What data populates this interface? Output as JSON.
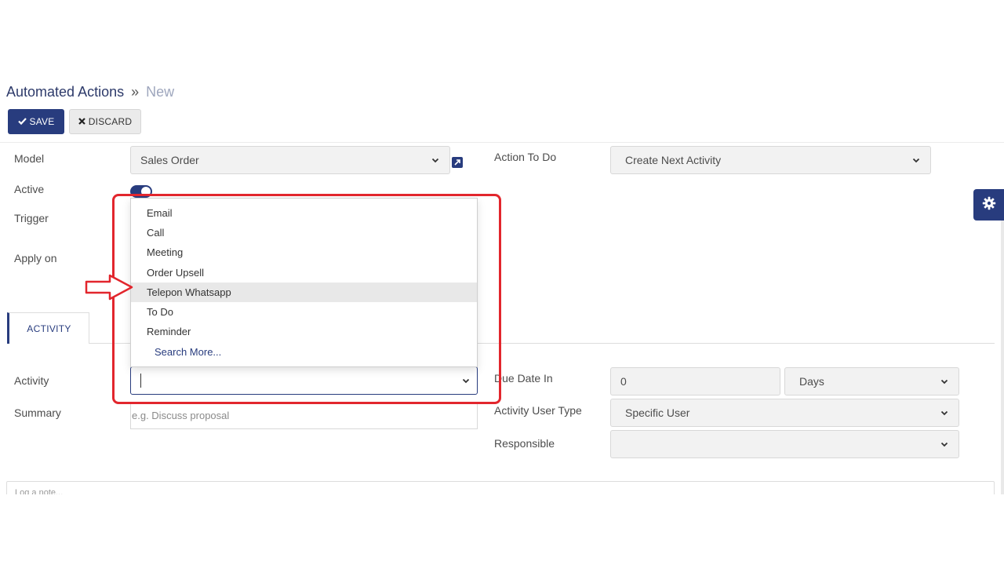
{
  "breadcrumb": {
    "parent": "Automated Actions",
    "separator": "»",
    "current": "New"
  },
  "toolbar": {
    "save_label": "SAVE",
    "discard_label": "DISCARD"
  },
  "form": {
    "model": {
      "label": "Model",
      "value": "Sales Order"
    },
    "active": {
      "label": "Active",
      "checked": true
    },
    "trigger": {
      "label": "Trigger"
    },
    "apply_on": {
      "label": "Apply on"
    },
    "action_to_do": {
      "label": "Action To Do",
      "value": "Create Next Activity"
    }
  },
  "tabs": [
    {
      "label": "ACTIVITY",
      "active": true
    }
  ],
  "activity_dropdown": {
    "options": [
      "Email",
      "Call",
      "Meeting",
      "Order Upsell",
      "Telepon Whatsapp",
      "To Do",
      "Reminder"
    ],
    "highlighted": "Telepon Whatsapp",
    "search_more": "Search More..."
  },
  "activity_fields": {
    "activity": {
      "label": "Activity",
      "value": ""
    },
    "summary": {
      "label": "Summary",
      "placeholder": "e.g. Discuss proposal"
    },
    "due_date_in": {
      "label": "Due Date In",
      "value": "0",
      "unit": "Days"
    },
    "activity_user_type": {
      "label": "Activity User Type",
      "value": "Specific User"
    },
    "responsible": {
      "label": "Responsible",
      "value": ""
    }
  },
  "chatter": {
    "placeholder": "Log a note..."
  },
  "colors": {
    "primary": "#283c7e",
    "annotation": "#e2262d"
  },
  "icons": [
    "check-icon",
    "times-icon",
    "external-link-icon",
    "chevron-down-icon",
    "gear-icon",
    "arrow-pointer-icon"
  ]
}
